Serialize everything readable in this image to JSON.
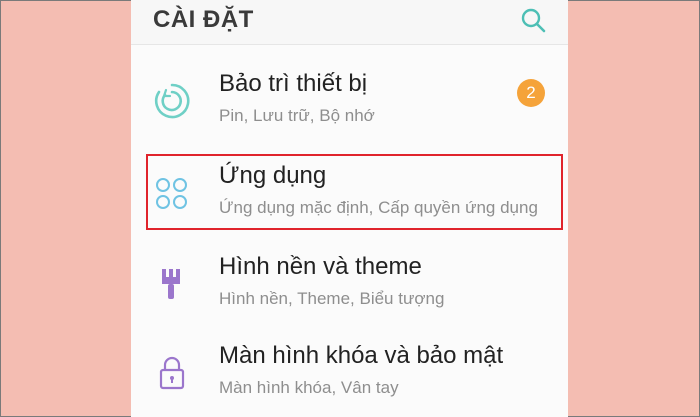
{
  "header": {
    "title": "CÀI ĐẶT"
  },
  "colors": {
    "background": "#f4bdb2",
    "highlight": "#e0242c",
    "badge": "#f5a33a",
    "teal_icon": "#4dbfb5",
    "light_blue_icon": "#6fc3e3",
    "purple_icon": "#9b76cc"
  },
  "settings": [
    {
      "title": "Bảo trì thiết bị",
      "subtitle": "Pin, Lưu trữ, Bộ nhớ",
      "icon": "device-maintenance-icon",
      "badge": "2"
    },
    {
      "title": "Ứng dụng",
      "subtitle": "Ứng dụng mặc định, Cấp quyền ứng dụng",
      "icon": "apps-icon"
    },
    {
      "title": "Hình nền và theme",
      "subtitle": "Hình nền, Theme, Biểu tượng",
      "icon": "paintbrush-icon"
    },
    {
      "title": "Màn hình khóa và bảo mật",
      "subtitle": "Màn hình khóa, Vân tay",
      "icon": "lock-icon"
    }
  ]
}
